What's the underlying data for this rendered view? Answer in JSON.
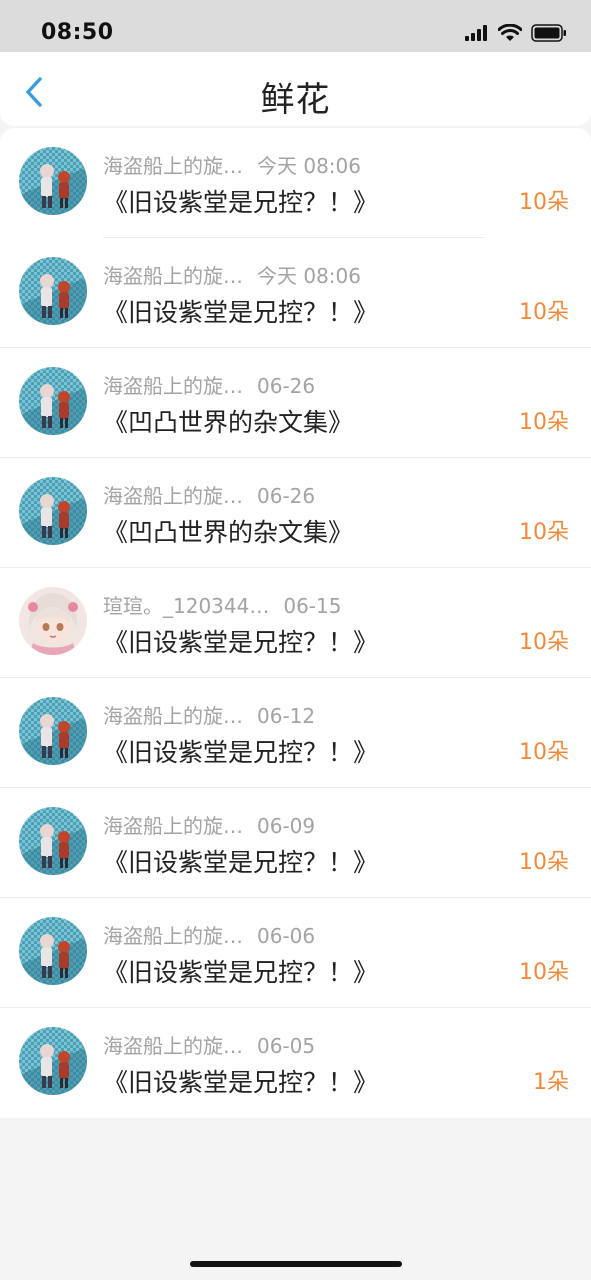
{
  "status_bar": {
    "time": "08:50"
  },
  "header": {
    "title": "鲜花"
  },
  "rows": [
    {
      "user": "海盗船上的旋…",
      "date": "今天 08:06",
      "book": "《旧设紫堂是兄控？！》",
      "count": "10朵",
      "avatar": "pirate"
    },
    {
      "user": "海盗船上的旋…",
      "date": "今天 08:06",
      "book": "《旧设紫堂是兄控？！》",
      "count": "10朵",
      "avatar": "pirate"
    },
    {
      "user": "海盗船上的旋…",
      "date": "06-26",
      "book": "《凹凸世界的杂文集》",
      "count": "10朵",
      "avatar": "pirate"
    },
    {
      "user": "海盗船上的旋…",
      "date": "06-26",
      "book": "《凹凸世界的杂文集》",
      "count": "10朵",
      "avatar": "pirate"
    },
    {
      "user": "瑄瑄。_120344…",
      "date": "06-15",
      "book": "《旧设紫堂是兄控？！》",
      "count": "10朵",
      "avatar": "girl"
    },
    {
      "user": "海盗船上的旋…",
      "date": "06-12",
      "book": "《旧设紫堂是兄控？！》",
      "count": "10朵",
      "avatar": "pirate"
    },
    {
      "user": "海盗船上的旋…",
      "date": "06-09",
      "book": "《旧设紫堂是兄控？！》",
      "count": "10朵",
      "avatar": "pirate"
    },
    {
      "user": "海盗船上的旋…",
      "date": "06-06",
      "book": "《旧设紫堂是兄控？！》",
      "count": "10朵",
      "avatar": "pirate"
    },
    {
      "user": "海盗船上的旋…",
      "date": "06-05",
      "book": "《旧设紫堂是兄控？！》",
      "count": "1朵",
      "avatar": "pirate"
    }
  ],
  "colors": {
    "accent": "#ef8a3c",
    "back": "#3a9fdc"
  },
  "icons": {
    "back": "chevron-left-icon",
    "signal": "signal-icon",
    "wifi": "wifi-icon",
    "battery": "battery-icon"
  }
}
